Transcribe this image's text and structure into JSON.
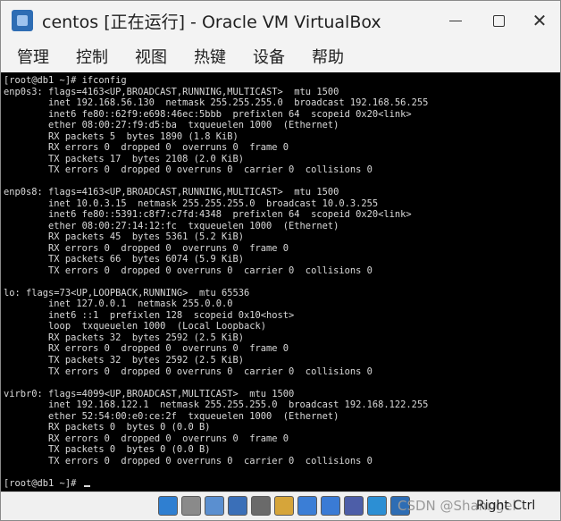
{
  "window": {
    "title": "centos [正在运行] - Oracle VM VirtualBox",
    "minimize_icon": "minimize-icon",
    "maximize_icon": "maximize-icon",
    "close_icon": "close-icon",
    "close_glyph": "✕"
  },
  "menubar": {
    "items": [
      {
        "label": "管理"
      },
      {
        "label": "控制"
      },
      {
        "label": "视图"
      },
      {
        "label": "热键"
      },
      {
        "label": "设备"
      },
      {
        "label": "帮助"
      }
    ]
  },
  "terminal": {
    "lines": [
      "[root@db1 ~]# ifconfig",
      "enp0s3: flags=4163<UP,BROADCAST,RUNNING,MULTICAST>  mtu 1500",
      "        inet 192.168.56.130  netmask 255.255.255.0  broadcast 192.168.56.255",
      "        inet6 fe80::62f9:e698:46ec:5bbb  prefixlen 64  scopeid 0x20<link>",
      "        ether 08:00:27:f9:d5:ba  txqueuelen 1000  (Ethernet)",
      "        RX packets 5  bytes 1890 (1.8 KiB)",
      "        RX errors 0  dropped 0  overruns 0  frame 0",
      "        TX packets 17  bytes 2108 (2.0 KiB)",
      "        TX errors 0  dropped 0 overruns 0  carrier 0  collisions 0",
      "",
      "enp0s8: flags=4163<UP,BROADCAST,RUNNING,MULTICAST>  mtu 1500",
      "        inet 10.0.3.15  netmask 255.255.255.0  broadcast 10.0.3.255",
      "        inet6 fe80::5391:c8f7:c7fd:4348  prefixlen 64  scopeid 0x20<link>",
      "        ether 08:00:27:14:12:fc  txqueuelen 1000  (Ethernet)",
      "        RX packets 45  bytes 5361 (5.2 KiB)",
      "        RX errors 0  dropped 0  overruns 0  frame 0",
      "        TX packets 66  bytes 6074 (5.9 KiB)",
      "        TX errors 0  dropped 0 overruns 0  carrier 0  collisions 0",
      "",
      "lo: flags=73<UP,LOOPBACK,RUNNING>  mtu 65536",
      "        inet 127.0.0.1  netmask 255.0.0.0",
      "        inet6 ::1  prefixlen 128  scopeid 0x10<host>",
      "        loop  txqueuelen 1000  (Local Loopback)",
      "        RX packets 32  bytes 2592 (2.5 KiB)",
      "        RX errors 0  dropped 0  overruns 0  frame 0",
      "        TX packets 32  bytes 2592 (2.5 KiB)",
      "        TX errors 0  dropped 0 overruns 0  carrier 0  collisions 0",
      "",
      "virbr0: flags=4099<UP,BROADCAST,MULTICAST>  mtu 1500",
      "        inet 192.168.122.1  netmask 255.255.255.0  broadcast 192.168.122.255",
      "        ether 52:54:00:e0:ce:2f  txqueuelen 1000  (Ethernet)",
      "        RX packets 0  bytes 0 (0.0 B)",
      "        RX errors 0  dropped 0  overruns 0  frame 0",
      "        TX packets 0  bytes 0 (0.0 B)",
      "        TX errors 0  dropped 0 overruns 0  carrier 0  collisions 0",
      "",
      "[root@db1 ~]# "
    ]
  },
  "statusbar": {
    "icons": [
      {
        "name": "hard-disk-icon",
        "color": "#2f7fd1"
      },
      {
        "name": "optical-drive-icon",
        "color": "#8a8a8a"
      },
      {
        "name": "audio-icon",
        "color": "#5a8fd0"
      },
      {
        "name": "network-icon",
        "color": "#3a6fb8"
      },
      {
        "name": "usb-icon",
        "color": "#6a6a6a"
      },
      {
        "name": "shared-folders-icon",
        "color": "#d6a53a"
      },
      {
        "name": "display-icon",
        "color": "#3b7ed6"
      },
      {
        "name": "video-capture-icon",
        "color": "#3a7bd5"
      },
      {
        "name": "virtualization-icon",
        "color": "#4d5ea8"
      },
      {
        "name": "mouse-integration-icon",
        "color": "#2c8fd4"
      },
      {
        "name": "arrow-icon",
        "color": "#2e6db4"
      }
    ],
    "watermark": "CSDN @Shanngel",
    "host_key": "Right Ctrl"
  }
}
